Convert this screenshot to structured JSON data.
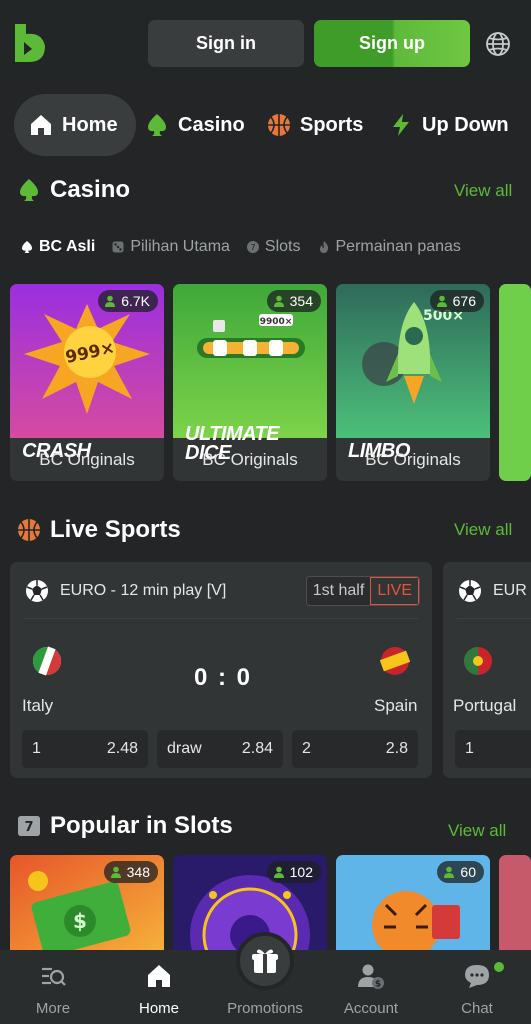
{
  "header": {
    "signin_label": "Sign in",
    "signup_label": "Sign up",
    "brand_color": "#5dba39"
  },
  "topnav": {
    "items": [
      {
        "label": "Home",
        "icon": "home-icon"
      },
      {
        "label": "Casino",
        "icon": "spade-icon"
      },
      {
        "label": "Sports",
        "icon": "basketball-icon"
      },
      {
        "label": "Up Down",
        "icon": "lightning-icon"
      }
    ]
  },
  "casino": {
    "title": "Casino",
    "view_all": "View all",
    "tabs": [
      {
        "label": "BC Asli",
        "icon": "spade-icon",
        "active": true
      },
      {
        "label": "Pilihan Utama",
        "icon": "dice-icon"
      },
      {
        "label": "Slots",
        "icon": "slots-icon"
      },
      {
        "label": "Permainan panas",
        "icon": "fire-icon"
      }
    ],
    "games": [
      {
        "name": "CRASH",
        "badge": "999×",
        "players": "6.7K",
        "caption": "BC Originals"
      },
      {
        "name": "ULTIMATE DICE",
        "badge": "9900×",
        "players": "354",
        "caption": "BC Originals"
      },
      {
        "name": "LIMBO",
        "badge": "500×",
        "players": "676",
        "caption": "BC Originals"
      }
    ]
  },
  "live_sports": {
    "title": "Live Sports",
    "view_all": "View all",
    "matches": [
      {
        "league": "EURO - 12 min play [V]",
        "phase": "1st half",
        "live": "LIVE",
        "home": "Italy",
        "away": "Spain",
        "score": "0 : 0",
        "odds": [
          {
            "label": "1",
            "value": "2.48"
          },
          {
            "label": "draw",
            "value": "2.84"
          },
          {
            "label": "2",
            "value": "2.8"
          }
        ]
      },
      {
        "league": "EUR",
        "home": "Portugal",
        "odds": [
          {
            "label": "1",
            "value": ""
          }
        ]
      }
    ]
  },
  "slots": {
    "title": "Popular in Slots",
    "view_all": "View all",
    "games": [
      {
        "players": "348"
      },
      {
        "players": "102"
      },
      {
        "players": "60"
      }
    ]
  },
  "bottom_nav": {
    "items": [
      {
        "label": "More",
        "icon": "menu-search-icon"
      },
      {
        "label": "Home",
        "icon": "home-icon",
        "active": true
      },
      {
        "label": "Promotions",
        "icon": "gift-icon"
      },
      {
        "label": "Account",
        "icon": "account-icon"
      },
      {
        "label": "Chat",
        "icon": "chat-icon"
      }
    ]
  }
}
